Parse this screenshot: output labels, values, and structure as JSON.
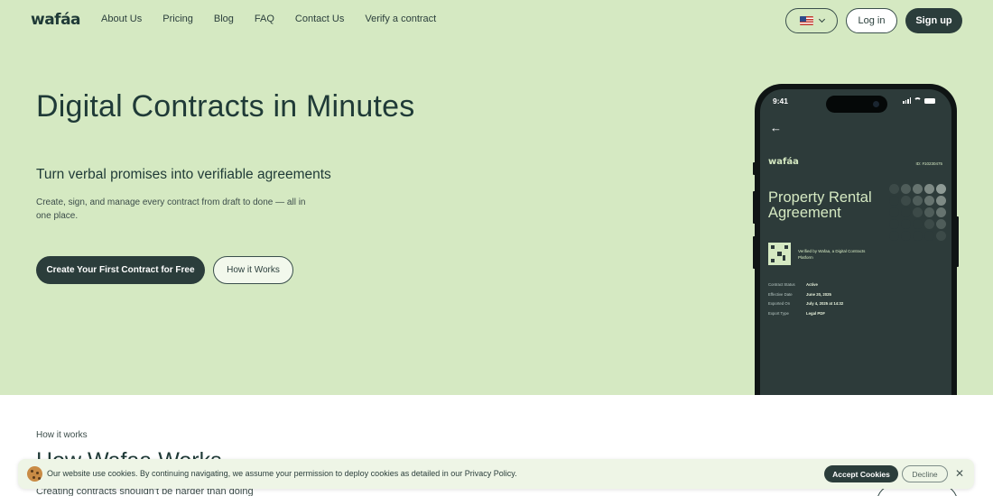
{
  "header": {
    "logo": "wafáa",
    "nav": [
      "About Us",
      "Pricing",
      "Blog",
      "FAQ",
      "Contact Us",
      "Verify a contract"
    ],
    "language_icon": "us-flag-icon",
    "login_label": "Log in",
    "signup_label": "Sign up"
  },
  "hero": {
    "title": "Digital Contracts in Minutes",
    "subtitle": "Turn verbal promises into verifiable agreements",
    "description": "Create, sign, and manage every contract from draft to done — all in one place.",
    "cta_primary": "Create Your First Contract for Free",
    "cta_secondary": "How it Works"
  },
  "phone": {
    "time": "9:41",
    "logo": "wafáa",
    "id_text": "ID: #10230475",
    "doc_title": "Property Rental Agreement",
    "verified_text": "Verified by Wafaa, a Digital Contracts Platform",
    "meta": [
      {
        "k": "Contract Status",
        "v": "Active"
      },
      {
        "k": "Effective Date",
        "v": "June 20, 2025"
      },
      {
        "k": "Exported On",
        "v": "July 4, 2025 at 14:32"
      },
      {
        "k": "Export Type",
        "v": "Legal PDF"
      }
    ]
  },
  "how": {
    "label": "How it works",
    "title": "How Wafaa Works",
    "description": "Creating contracts shouldn't be harder than doing"
  },
  "cookie": {
    "text": "Our website use cookies. By continuing navigating, we assume your permission to deploy cookies as detailed in our Privacy Policy.",
    "accept_label": "Accept Cookies",
    "decline_label": "Decline",
    "close_label": "✕"
  },
  "colors": {
    "hero_bg": "#d5e9c2",
    "dark": "#2b3d3b",
    "phone_screen": "#2d3b3a",
    "accent_light": "#d5e9c2"
  }
}
